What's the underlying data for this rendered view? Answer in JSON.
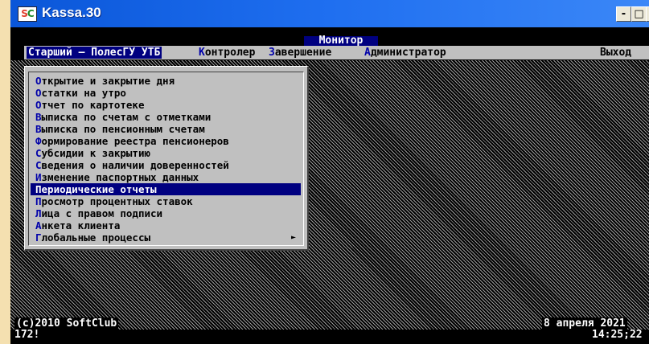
{
  "window": {
    "title": "Kassa.30",
    "icon_text": "SC",
    "controls": {
      "minimize": "-",
      "maximize": "□",
      "close": "×"
    }
  },
  "screen": {
    "title": "Монитор",
    "menubar": {
      "user": "Старший – ПолесГУ УТБ",
      "items": [
        {
          "hotkey": "К",
          "rest": "онтролер"
        },
        {
          "hotkey": "З",
          "rest": "авершение"
        },
        {
          "hotkey": "А",
          "rest": "дминистратор"
        }
      ],
      "exit": "Выход"
    },
    "dropdown": {
      "items": [
        {
          "hotkey": "О",
          "rest": "ткрытие и закрытие дня"
        },
        {
          "hotkey": "О",
          "rest": "статки на утро"
        },
        {
          "hotkey": "О",
          "rest": "тчет по картотеке"
        },
        {
          "hotkey": "В",
          "rest": "ыписка по счетам с отметками"
        },
        {
          "hotkey": "В",
          "rest": "ыписка по пенсионным счетам"
        },
        {
          "hotkey": "Ф",
          "rest": "ормирование реестра пенсионеров"
        },
        {
          "hotkey": "С",
          "rest": "убсидии к закрытию"
        },
        {
          "hotkey": "С",
          "rest": "ведения о наличии доверенностей"
        },
        {
          "hotkey": "И",
          "rest": "зменение паспортных данных"
        },
        {
          "hotkey": "П",
          "rest": "ериодические отчеты"
        },
        {
          "hotkey": "П",
          "rest": "росмотр процентных ставок"
        },
        {
          "hotkey": "Л",
          "rest": "ица с правом подписи"
        },
        {
          "hotkey": "А",
          "rest": "нкета клиента"
        },
        {
          "hotkey": "Г",
          "rest": "лобальные процессы",
          "submenu": "►"
        }
      ],
      "selected_index": 9
    },
    "status": {
      "copyright": "(c)2010 SoftClub",
      "code": "172!",
      "date": "8 апреля 2021",
      "time": "14:25;22"
    }
  },
  "colors": {
    "titlebar": "#0a56d8",
    "menu_bg": "#c0c0c0",
    "selection": "#000080",
    "hotkey": "#0000aa"
  }
}
